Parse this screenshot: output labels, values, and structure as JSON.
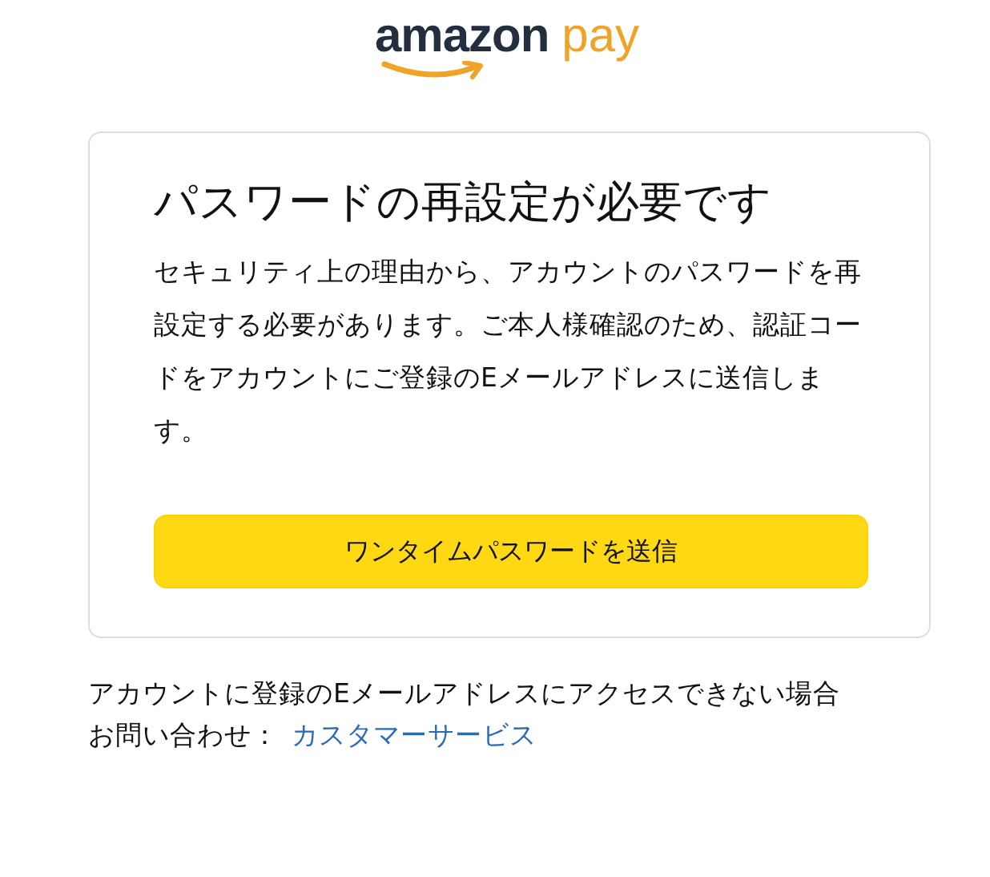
{
  "logo": {
    "brand": "amazon",
    "product": "pay"
  },
  "card": {
    "title": "パスワードの再設定が必要です",
    "message": "セキュリティ上の理由から、アカウントのパスワードを再設定する必要があります。ご本人様確認のため、認証コードをアカウントにご登録のEメールアドレスに送信します。",
    "button": "ワンタイムパスワードを送信"
  },
  "help": {
    "text": "アカウントに登録のEメールアドレスにアクセスできない場合",
    "contact_label": "お問い合わせ：",
    "contact_link": "カスタマーサービス"
  }
}
